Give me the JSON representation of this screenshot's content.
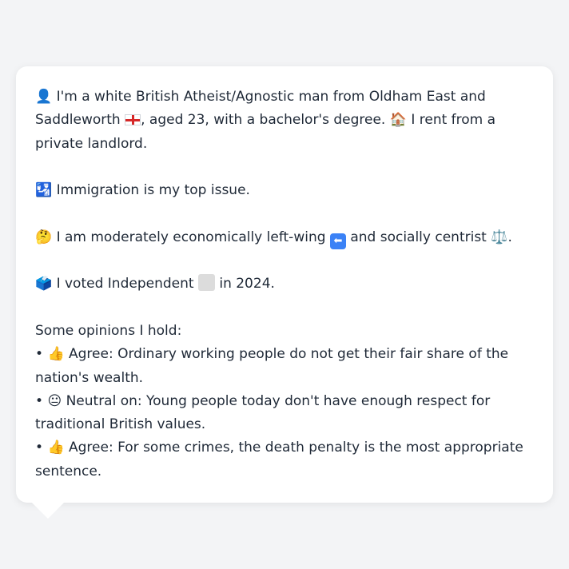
{
  "profile": {
    "intro": {
      "person_icon": "👤",
      "text_1": "I'm a white British Atheist/Agnostic man from Oldham East and Saddleworth",
      "flag_icon": "england-flag-icon",
      "text_2": ", aged 23, with a bachelor's degree.",
      "house_icon": "🏠",
      "text_3": "I rent from a private landlord."
    },
    "top_issue": {
      "icon": "🛂",
      "text": "Immigration is my top issue."
    },
    "politics": {
      "thinking_icon": "🤔",
      "text_1": "I am moderately economically left-wing",
      "left_arrow_icon": "⬅",
      "text_2": "and socially centrist",
      "scales_icon": "⚖️",
      "text_3": "."
    },
    "vote": {
      "ballot_icon": "🗳️",
      "text_1": "I voted Independent",
      "party_color_icon": "gray-square-icon",
      "text_2": "in 2024."
    },
    "opinions_heading": "Some opinions I hold:",
    "opinions": [
      {
        "bullet": "•",
        "icon": "👍",
        "text": "Agree: Ordinary working people do not get their fair share of the nation's wealth."
      },
      {
        "bullet": "•",
        "icon": "😐",
        "text": "Neutral on: Young people today don't have enough respect for traditional British values."
      },
      {
        "bullet": "•",
        "icon": "👍",
        "text": "Agree: For some crimes, the death penalty is the most appropriate sentence."
      }
    ]
  }
}
